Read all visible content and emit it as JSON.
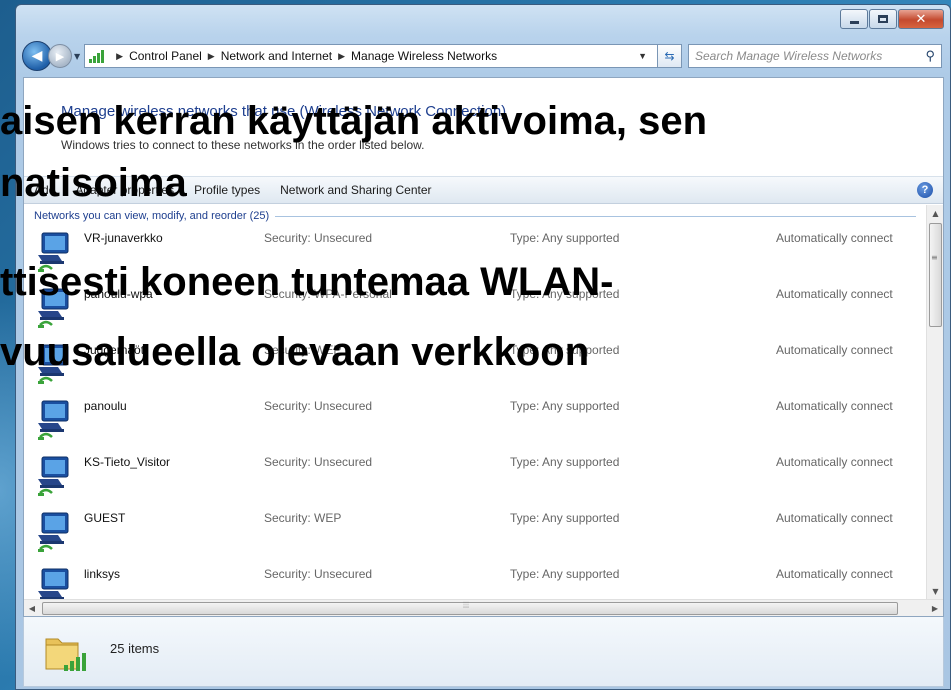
{
  "address_bar": {
    "crumbs": [
      "Control Panel",
      "Network and Internet",
      "Manage Wireless Networks"
    ]
  },
  "search": {
    "placeholder": "Search Manage Wireless Networks"
  },
  "page": {
    "heading": "Manage wireless networks that use (Wireless Network Connection)",
    "subheading": "Windows tries to connect to these networks in the order listed below."
  },
  "toolbar": {
    "items": [
      "Add",
      "Adapter properties",
      "Profile types",
      "Network and Sharing Center"
    ]
  },
  "group": {
    "header": "Networks you can view, modify, and reorder (25)"
  },
  "networks": [
    {
      "name": "VR-junaverkko",
      "security": "Security: Unsecured",
      "type": "Type: Any supported",
      "auto": "Automatically connect"
    },
    {
      "name": "panoulu-wpa",
      "security": "Security: WPA-Personal",
      "type": "Type: Any supported",
      "auto": "Automatically connect"
    },
    {
      "name": "Juggernaöt",
      "security": "Security: WEP",
      "type": "Type: Any supported",
      "auto": "Automatically connect"
    },
    {
      "name": "panoulu",
      "security": "Security: Unsecured",
      "type": "Type: Any supported",
      "auto": "Automatically connect"
    },
    {
      "name": "KS-Tieto_Visitor",
      "security": "Security: Unsecured",
      "type": "Type: Any supported",
      "auto": "Automatically connect"
    },
    {
      "name": "GUEST",
      "security": "Security: WEP",
      "type": "Type: Any supported",
      "auto": "Automatically connect"
    },
    {
      "name": "linksys",
      "security": "Security: Unsecured",
      "type": "Type: Any supported",
      "auto": "Automatically connect"
    }
  ],
  "details": {
    "item_count": "25 items"
  },
  "overlay": {
    "line1": "aisen kerran käyttäjän aktivoima, sen",
    "line2": "natisoima",
    "line3": "ttisesti koneen tuntemaa WLAN-",
    "line4": "vuusalueella olevaan verkkoon"
  },
  "icons": {
    "back": "back-arrow-icon",
    "forward": "forward-arrow-icon",
    "refresh": "refresh-icon",
    "search": "search-icon",
    "help": "help-icon",
    "network": "wireless-network-icon"
  },
  "colors": {
    "link_blue": "#1e3f8f",
    "close_red": "#c44a2f",
    "desktop_blue": "#2a79ad"
  }
}
